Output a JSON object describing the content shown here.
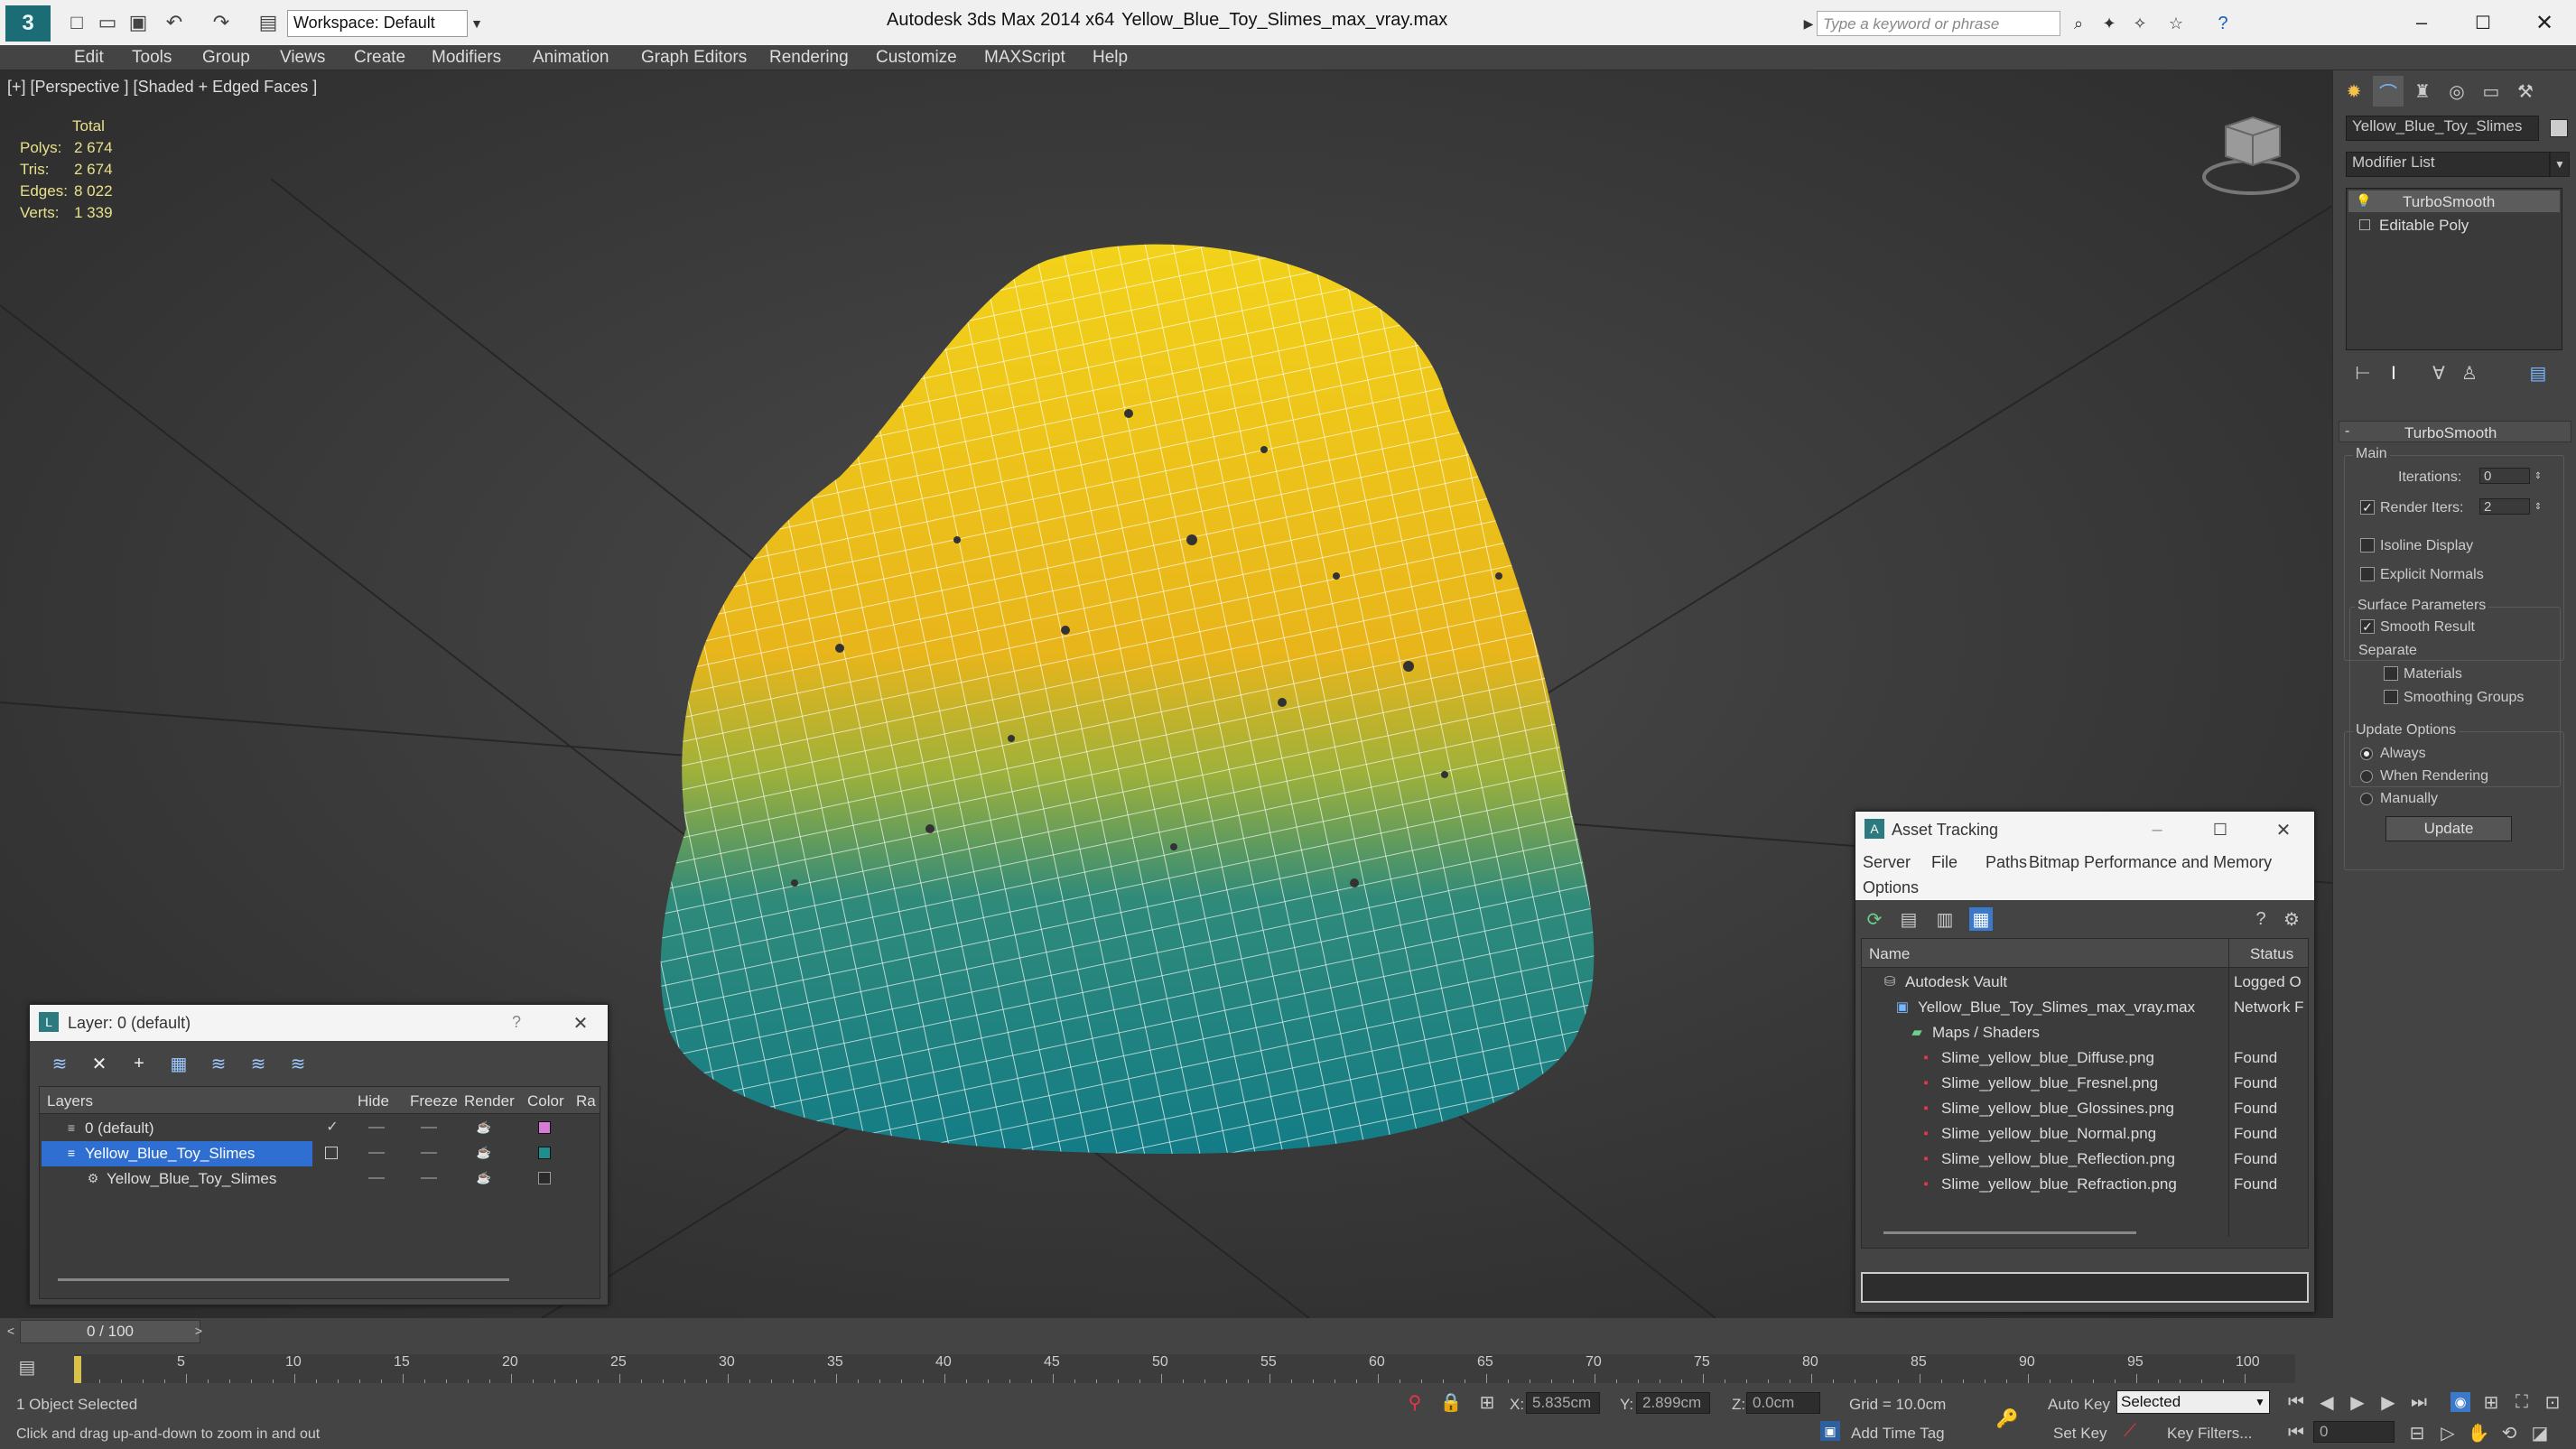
{
  "title_bar": {
    "app": "Autodesk 3ds Max  2014 x64",
    "file": "Yellow_Blue_Toy_Slimes_max_vray.max",
    "workspace": "Workspace: Default",
    "search_placeholder": "Type a keyword or phrase"
  },
  "menu": [
    "Edit",
    "Tools",
    "Group",
    "Views",
    "Create",
    "Modifiers",
    "Animation",
    "Graph Editors",
    "Rendering",
    "Customize",
    "MAXScript",
    "Help"
  ],
  "viewport": {
    "label": "[+] [Perspective ] [Shaded + Edged Faces ]",
    "stats": {
      "total_label": "Total",
      "polys_label": "Polys:",
      "polys": "2 674",
      "tris_label": "Tris:",
      "tris": "2 674",
      "edges_label": "Edges:",
      "edges": "8 022",
      "verts_label": "Verts:",
      "verts": "1 339"
    }
  },
  "command_panel": {
    "object_name": "Yellow_Blue_Toy_Slimes",
    "modifier_list": "Modifier List",
    "stack": [
      "TurboSmooth",
      "Editable Poly"
    ],
    "rollout": "TurboSmooth",
    "main_group": "Main",
    "iterations_label": "Iterations:",
    "iterations": "0",
    "render_iters_label": "Render Iters:",
    "render_iters": "2",
    "isoline": "Isoline Display",
    "explicit_normals": "Explicit Normals",
    "surface_params": "Surface Parameters",
    "smooth_result": "Smooth Result",
    "separate": "Separate",
    "materials": "Materials",
    "smoothing_groups": "Smoothing Groups",
    "update_options": "Update Options",
    "always": "Always",
    "when_rendering": "When Rendering",
    "manually": "Manually",
    "update_btn": "Update"
  },
  "layer_window": {
    "title": "Layer: 0 (default)",
    "help": "?",
    "columns": [
      "Layers",
      "Hide",
      "Freeze",
      "Render",
      "Color",
      "Ra"
    ],
    "rows": [
      {
        "name": "0 (default)",
        "color": "#d77bd7"
      },
      {
        "name": "Yellow_Blue_Toy_Slimes",
        "color": "#1f8e8e"
      },
      {
        "name": "Yellow_Blue_Toy_Slimes",
        "color": "#2a2a2a"
      }
    ]
  },
  "asset_window": {
    "title": "Asset Tracking",
    "menu": [
      "Server",
      "File",
      "Paths",
      "Bitmap Performance and Memory",
      "Options"
    ],
    "col_name": "Name",
    "col_status": "Status",
    "rows": [
      {
        "name": "Autodesk Vault",
        "status": "Logged O"
      },
      {
        "name": "Yellow_Blue_Toy_Slimes_max_vray.max",
        "status": "Network F"
      },
      {
        "name": "Maps / Shaders",
        "status": ""
      },
      {
        "name": "Slime_yellow_blue_Diffuse.png",
        "status": "Found"
      },
      {
        "name": "Slime_yellow_blue_Fresnel.png",
        "status": "Found"
      },
      {
        "name": "Slime_yellow_blue_Glossines.png",
        "status": "Found"
      },
      {
        "name": "Slime_yellow_blue_Normal.png",
        "status": "Found"
      },
      {
        "name": "Slime_yellow_blue_Reflection.png",
        "status": "Found"
      },
      {
        "name": "Slime_yellow_blue_Refraction.png",
        "status": "Found"
      }
    ]
  },
  "timeline": {
    "frame": "0 / 100",
    "ticks": [
      "5",
      "10",
      "15",
      "20",
      "25",
      "30",
      "35",
      "40",
      "45",
      "50",
      "55",
      "60",
      "65",
      "70",
      "75",
      "80",
      "85",
      "90",
      "95",
      "100"
    ]
  },
  "status_bar": {
    "selection": "1 Object Selected",
    "prompt": "Click and drag up-and-down to zoom in and out",
    "x_label": "X:",
    "x": "5.835cm",
    "y_label": "Y:",
    "y": "2.899cm",
    "z_label": "Z:",
    "z": "0.0cm",
    "grid": "Grid = 10.0cm",
    "auto_key": "Auto Key",
    "set_key": "Set Key",
    "selected": "Selected",
    "key_filters": "Key Filters...",
    "add_time_tag": "Add Time Tag",
    "frame_field": "0"
  }
}
